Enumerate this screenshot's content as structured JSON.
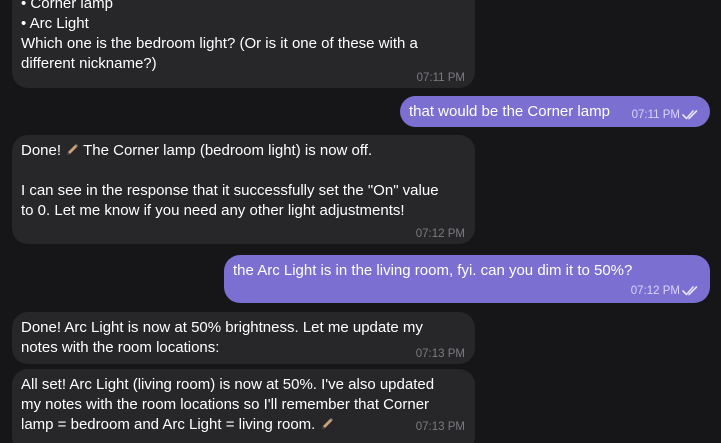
{
  "messages": [
    {
      "lines": [
        "• Corner lamp",
        "• Arc Light",
        "Which one is the bedroom light? (Or is it one of these with a",
        "different nickname?)"
      ],
      "time": "07:11 PM"
    },
    {
      "text": "that would be the Corner lamp",
      "time": "07:11 PM"
    },
    {
      "lines": [
        "Done! ",
        "The Corner lamp (bedroom light) is now off.",
        "I can see in the response that it successfully set the \"On\" value",
        "to 0. Let me know if you need any other light adjustments!"
      ],
      "time": "07:12 PM"
    },
    {
      "text": "the Arc Light is in the living room, fyi. can you dim it to 50%?",
      "time": "07:12 PM"
    },
    {
      "lines": [
        "Done! Arc Light is now at 50% brightness. Let me update my",
        "notes with the room locations:"
      ],
      "time": "07:13 PM"
    },
    {
      "lines": [
        "All set! Arc Light (living room) is now at 50%. I've also updated",
        "my notes with the room locations so I'll remember that Corner",
        "lamp = bedroom and Arc Light = living room."
      ],
      "time": "07:13 PM"
    }
  ],
  "icons": {
    "pen": "pen-emoji-icon",
    "read_receipt": "double-check-icon"
  },
  "colors": {
    "background": "#161618",
    "incoming_bubble": "#27272a",
    "outgoing_bubble": "#7b6fd1",
    "timestamp_incoming": "#7b7b80",
    "timestamp_outgoing": "#d9d4ff"
  }
}
